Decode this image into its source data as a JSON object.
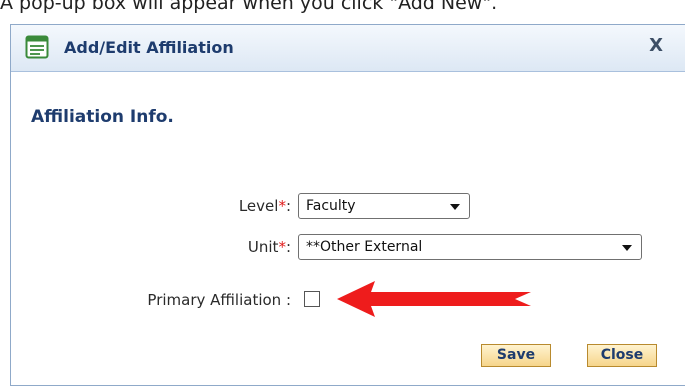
{
  "caption": "A pop-up box will appear when you click \"Add New\".",
  "dialog": {
    "title": "Add/Edit Affiliation",
    "close_label": "X"
  },
  "section": {
    "title": "Affiliation Info."
  },
  "form": {
    "level": {
      "label": "Level",
      "required_mark": "*",
      "colon": ":",
      "value": "Faculty"
    },
    "unit": {
      "label": "Unit",
      "required_mark": "*",
      "colon": ":",
      "value": "**Other External"
    },
    "primary": {
      "label": "Primary Affiliation :",
      "checked": false
    }
  },
  "buttons": {
    "save": "Save",
    "close": "Close"
  },
  "colors": {
    "accent_title": "#1e3c6e",
    "required": "#e01b1b",
    "arrow": "#ee1c1c",
    "button_bg": "#f6d58b"
  },
  "icons": {
    "title": "form-icon",
    "annotation": "red-arrow-icon"
  }
}
